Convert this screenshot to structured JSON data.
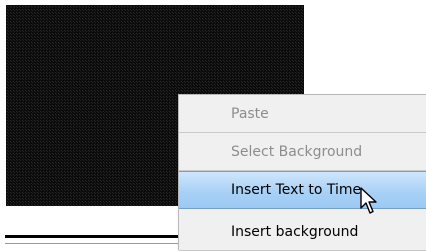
{
  "context_menu": {
    "items": [
      {
        "label": "Paste",
        "enabled": false
      },
      {
        "label": "Select Background",
        "enabled": false
      },
      {
        "label": "Insert Text to Time",
        "enabled": true,
        "selected": true
      },
      {
        "label": "Insert background",
        "enabled": true
      }
    ]
  },
  "cursor": {
    "icon": "arrow-pointer-icon"
  }
}
